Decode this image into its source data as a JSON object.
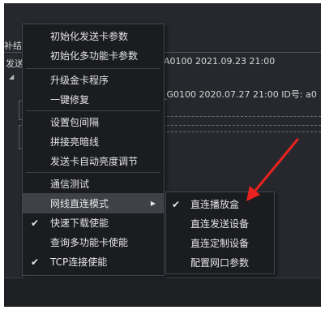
{
  "background": {
    "left_fragments": [
      "补结",
      "发送"
    ],
    "row1_text": "A0100 2021.09.23 21:00",
    "row2_text": "_G0100 2020.07.27 21:00 ID号: a0"
  },
  "menu": {
    "items": [
      {
        "label": "初始化发送卡参数"
      },
      {
        "label": "初始化多功能卡参数"
      },
      {
        "label": "升级金卡程序"
      },
      {
        "label": "一键修复"
      },
      {
        "label": "设置包间隔"
      },
      {
        "label": "拼接亮暗线"
      },
      {
        "label": "发送卡自动亮度调节"
      },
      {
        "label": "通信测试"
      },
      {
        "label": "网线直连模式",
        "arrow": "▶"
      },
      {
        "label": "快速下载使能",
        "check": "✔"
      },
      {
        "label": "查询多功能卡使能"
      },
      {
        "label": "TCP连接使能",
        "check": "✔"
      }
    ]
  },
  "submenu": {
    "items": [
      {
        "label": "直连播放盒",
        "check": "✔"
      },
      {
        "label": "直连发送设备"
      },
      {
        "label": "直连定制设备"
      },
      {
        "label": "配置网口参数"
      }
    ]
  },
  "colors": {
    "background": "#26282d",
    "menu_bg": "#1b1c20",
    "highlight": "#3f4148",
    "annotation_arrow": "#e8231f"
  }
}
